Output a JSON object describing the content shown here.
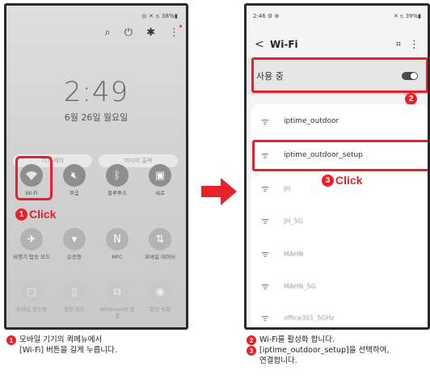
{
  "left_phone": {
    "status_right": "◎ ✕ ⦸ 38%▮",
    "toolbar": {
      "search_icon": "search-icon",
      "power_icon": "power-icon",
      "gear_icon": "gear-icon",
      "more_icon": "more-icon"
    },
    "time": "2:49",
    "date": "6월 26일 월요일",
    "pills": [
      "기기 제어",
      "미디어 출력"
    ],
    "tiles": [
      {
        "label": "Wi-Fi",
        "icon": "wifi-icon"
      },
      {
        "label": "무음",
        "icon": "mute-icon"
      },
      {
        "label": "블루투스",
        "icon": "bluetooth-icon"
      },
      {
        "label": "세로",
        "icon": "rotation-lock-icon"
      },
      {
        "label": "비행기 탑승 모드",
        "icon": "airplane-icon"
      },
      {
        "label": "손전등",
        "icon": "flashlight-icon"
      },
      {
        "label": "NFC",
        "icon": "nfc-icon"
      },
      {
        "label": "모바일 데이터",
        "icon": "mobile-data-icon"
      },
      {
        "label": "모바일 핫스팟",
        "icon": "hotspot-icon"
      },
      {
        "label": "절전 모드",
        "icon": "battery-saver-icon"
      },
      {
        "label": "Windows와 연결",
        "icon": "windows-link-icon"
      },
      {
        "label": "화면 녹화",
        "icon": "screen-record-icon"
      }
    ],
    "click_num": "1",
    "click_text": "Click"
  },
  "right_phone": {
    "status_left": "2:46 ⚙ ⊕",
    "status_right": "✕ ⦸ 39%▮",
    "title": "Wi-Fi",
    "in_use_label": "사용 중",
    "badge_num": "2",
    "networks": [
      "iptime_outdoor",
      "iptime_outdoor_setup",
      "JH",
      "JH_5G",
      "MAHN",
      "MAHN_5G",
      "office301_5GHz"
    ],
    "click_num": "3",
    "click_text": "Click"
  },
  "captions": {
    "left_num": "1",
    "left_line1": "모바일 기기의 퀵메뉴에서",
    "left_line2": "[Wi-Fi] 버튼을 길게 누릅니다.",
    "right_num2": "2",
    "right_line1": "Wi-Fi를 활성화 합니다.",
    "right_num3": "3",
    "right_line2": "[iptime_outdoor_setup]을 선택하여,",
    "right_line3": "연결합니다."
  },
  "colors": {
    "accent": "#e8202a"
  }
}
